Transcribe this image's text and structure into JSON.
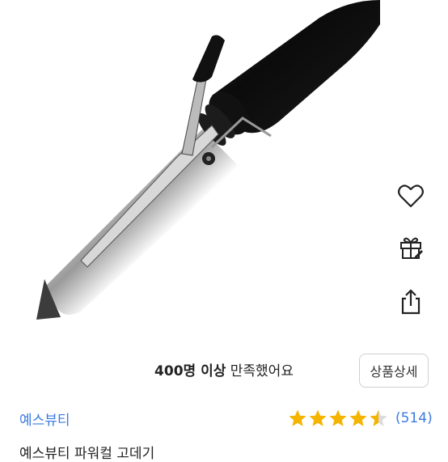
{
  "product": {
    "image_subject": "curling-iron-photo",
    "satisfaction_count": "400명 이상",
    "satisfaction_suffix": " 만족했어요",
    "detail_button": "상품상세",
    "brand": "예스뷰티",
    "rating": 4.5,
    "review_count": "(514)",
    "title_partial": "예스뷰티 파워컬 고데기"
  },
  "actions": [
    {
      "icon": "heart-icon"
    },
    {
      "icon": "gift-icon"
    },
    {
      "icon": "share-icon"
    }
  ],
  "colors": {
    "star": "#f5b400",
    "link": "#3b7be0"
  }
}
